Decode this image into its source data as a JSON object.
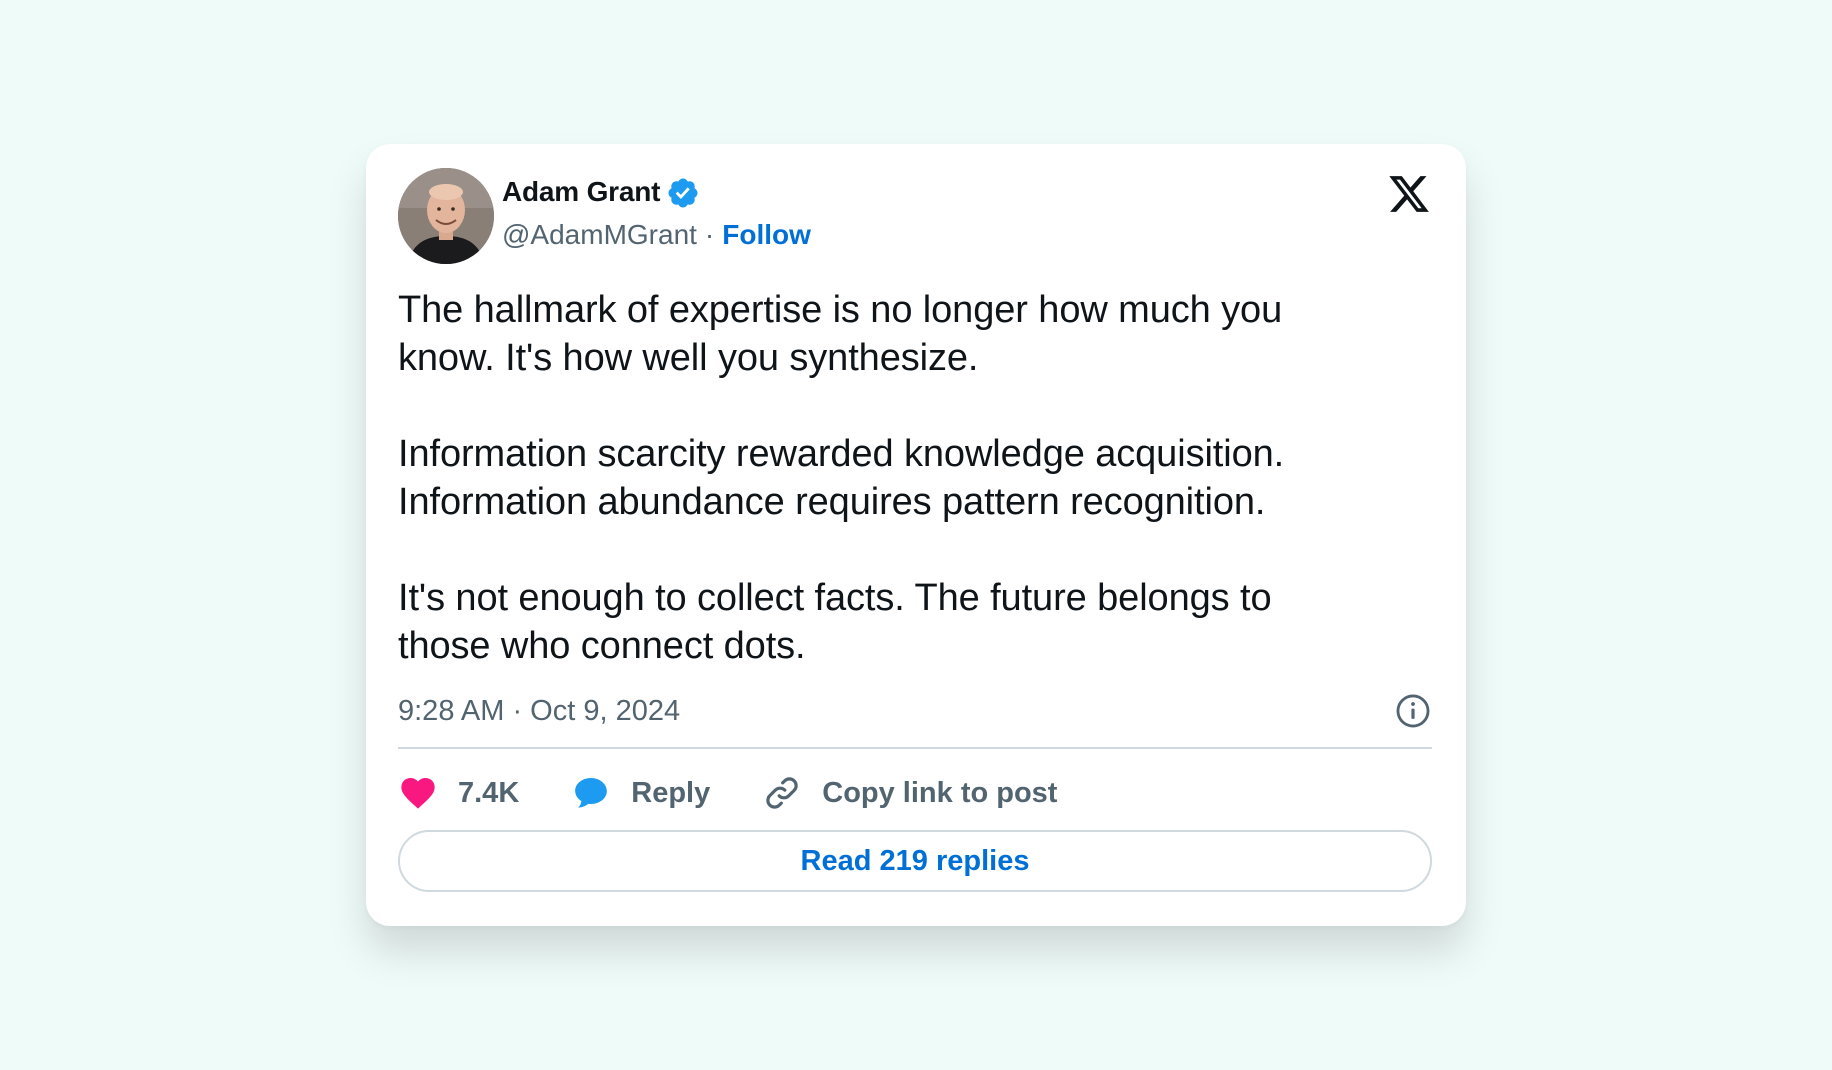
{
  "author": {
    "name": "Adam Grant",
    "handle": "@AdamMGrant",
    "verified": true,
    "separator": "·",
    "follow_label": "Follow",
    "avatar_icon": "profile-photo"
  },
  "platform_icon": "x-logo-icon",
  "tweet": {
    "paragraphs": [
      "The hallmark of expertise is no longer how much you\nknow. It's how well you synthesize.",
      "Information scarcity rewarded knowledge acquisition.\nInformation abundance requires pattern recognition.",
      "It's not enough to collect facts. The future belongs to\nthose who connect dots."
    ],
    "timestamp": "9:28 AM · Oct 9, 2024"
  },
  "actions": {
    "likes_label": "7.4K",
    "reply_label": "Reply",
    "copy_link_label": "Copy link to post"
  },
  "read_replies_label": "Read 219 replies",
  "colors": {
    "background": "#effbf9",
    "card": "#ffffff",
    "text": "#0f1419",
    "muted": "#536471",
    "link": "#006fd6",
    "like": "#f91880",
    "reply": "#1d9bf0",
    "verified": "#1d9bf0",
    "divider": "#cfd9de"
  }
}
